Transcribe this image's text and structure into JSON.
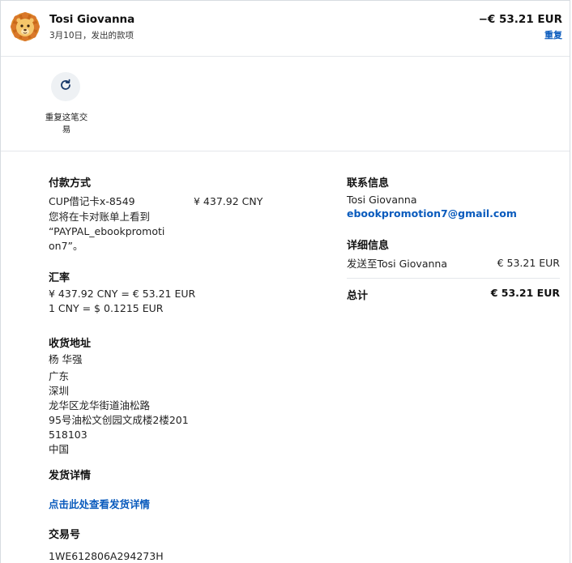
{
  "header": {
    "name": "Tosi Giovanna",
    "subtitle": "3月10日，发出的款项",
    "amount": "−€ 53.21 EUR",
    "repeat_link": "重复"
  },
  "action": {
    "repeat_label": "重复这笔交易",
    "icon": "refresh-icon"
  },
  "payment": {
    "title": "付款方式",
    "method": "CUP借记卡x-8549",
    "amount": "¥ 437.92 CNY",
    "statement_l1": "您将在卡对账单上看到",
    "statement_l2": "“PAYPAL_ebookpromoti",
    "statement_l3": "on7”。"
  },
  "exchange": {
    "title": "汇率",
    "line1": "¥ 437.92 CNY = € 53.21 EUR",
    "line2": "1 CNY = $ 0.1215 EUR"
  },
  "shipping": {
    "title": "收货地址",
    "lines": [
      "杨 华强",
      "广东",
      "深圳",
      "龙华区龙华街道油松路",
      "95号油松文创园文成楼2楼201",
      "518103",
      "中国"
    ]
  },
  "delivery": {
    "title": "发货详情",
    "link": "点击此处查看发货详情"
  },
  "transaction": {
    "title": "交易号",
    "id": "1WE612806A294273H"
  },
  "contact": {
    "title": "联系信息",
    "name": "Tosi Giovanna",
    "email": "ebookpromotion7@gmail.com"
  },
  "details": {
    "title": "详细信息",
    "label": "发送至Tosi Giovanna",
    "amount": "€ 53.21 EUR",
    "total_label": "总计",
    "total_amount": "€ 53.21 EUR"
  }
}
